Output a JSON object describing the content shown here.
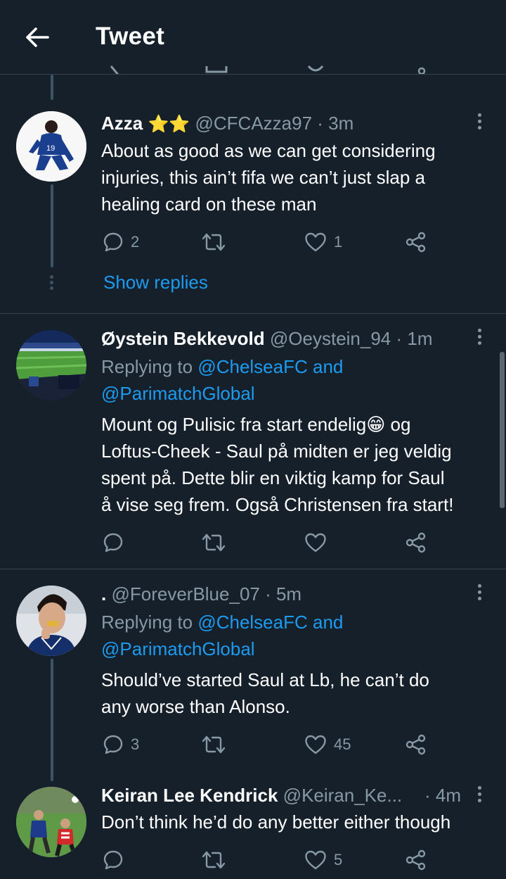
{
  "header": {
    "title": "Tweet"
  },
  "tweets": [
    {
      "name": "Azza",
      "name_suffix": "⭐⭐",
      "handle": "@CFCAzza97",
      "time": "· 3m",
      "text": "About as good as we can get considering injuries, this ain’t fifa we can’t just slap a healing card on these man",
      "replies": "2",
      "retweets": "",
      "likes": "1",
      "show_replies": "Show replies"
    },
    {
      "name": "Øystein Bekkevold",
      "handle": "@Oeystein_94",
      "time": "· 1m",
      "reply_prefix": "Replying to ",
      "reply_to_1": "@ChelseaFC and",
      "reply_to_2": "@ParimatchGlobal",
      "text_1": "Mount og Pulisic fra start endelig😁 og",
      "text_2": "Loftus-Cheek - Saul på midten er jeg veldig",
      "text_3": "spent på. Dette blir en viktig kamp for Saul",
      "text_4": "å vise seg frem. Også Christensen fra start!",
      "replies": "",
      "retweets": "",
      "likes": ""
    },
    {
      "name": ".",
      "handle": "@ForeverBlue_07",
      "time": "· 5m",
      "reply_prefix": "Replying to ",
      "reply_to_1": "@ChelseaFC and",
      "reply_to_2": "@ParimatchGlobal",
      "text_1": "Should’ve started Saul at Lb, he can’t do",
      "text_2": "any worse than Alonso.",
      "replies": "3",
      "retweets": "",
      "likes": "45"
    },
    {
      "name": "Keiran Lee Kendrick",
      "handle": "@Keiran_Ke...",
      "time": "· 4m",
      "text": "Don’t think he’d do any better either though",
      "replies": "",
      "retweets": "",
      "likes": "5"
    }
  ],
  "colors": {
    "background": "#15202b",
    "text": "#ffffff",
    "secondary": "#8899a6",
    "accent": "#1d9bf0",
    "divider": "#38444d",
    "thread_line": "#3d5466"
  },
  "icons": {
    "back": "arrow-left-icon",
    "reply": "comment-bubble-icon",
    "retweet": "retweet-icon",
    "like": "heart-icon",
    "share": "share-icon",
    "more": "more-vertical-icon"
  }
}
